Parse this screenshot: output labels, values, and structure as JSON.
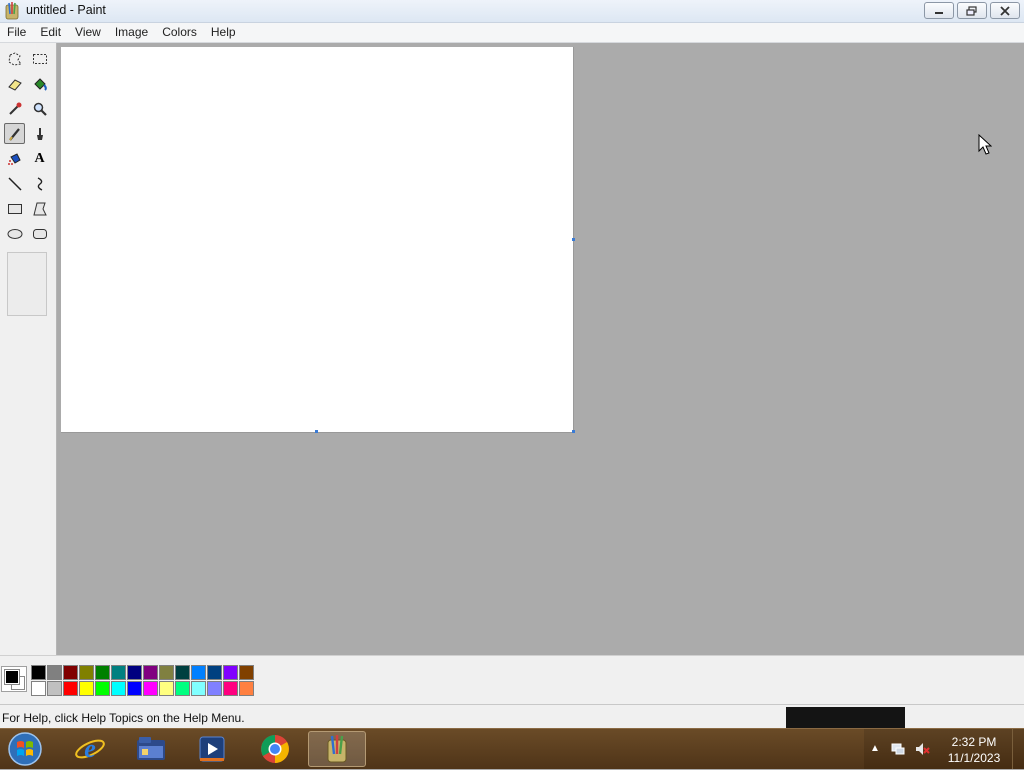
{
  "window": {
    "title": "untitled - Paint",
    "app_icon": "paint-brush-icon",
    "controls": [
      "minimize-icon",
      "restore-icon",
      "close-icon"
    ]
  },
  "menubar": {
    "items": [
      {
        "label": "File"
      },
      {
        "label": "Edit"
      },
      {
        "label": "View"
      },
      {
        "label": "Image"
      },
      {
        "label": "Colors"
      },
      {
        "label": "Help"
      }
    ]
  },
  "toolbox": {
    "tools": [
      {
        "name": "free-form-select-icon"
      },
      {
        "name": "rectangle-select-icon"
      },
      {
        "name": "eraser-icon"
      },
      {
        "name": "fill-bucket-icon"
      },
      {
        "name": "color-picker-icon"
      },
      {
        "name": "magnifier-icon"
      },
      {
        "name": "pencil-icon",
        "active": true
      },
      {
        "name": "brush-icon"
      },
      {
        "name": "airbrush-icon"
      },
      {
        "name": "text-icon",
        "glyph": "A"
      },
      {
        "name": "line-icon"
      },
      {
        "name": "curve-icon"
      },
      {
        "name": "rectangle-icon"
      },
      {
        "name": "polygon-icon"
      },
      {
        "name": "ellipse-icon"
      },
      {
        "name": "rounded-rectangle-icon"
      }
    ]
  },
  "palette": {
    "foreground": "#000000",
    "background": "#ffffff",
    "row1": [
      "#000000",
      "#808080",
      "#800000",
      "#808000",
      "#008000",
      "#008080",
      "#000080",
      "#800080",
      "#808040",
      "#004040",
      "#0080ff",
      "#004080",
      "#8000ff",
      "#804000"
    ],
    "row2": [
      "#ffffff",
      "#c0c0c0",
      "#ff0000",
      "#ffff00",
      "#00ff00",
      "#00ffff",
      "#0000ff",
      "#ff00ff",
      "#ffff80",
      "#00ff80",
      "#80ffff",
      "#8080ff",
      "#ff0080",
      "#ff8040"
    ]
  },
  "statusbar": {
    "help_text": "For Help, click Help Topics on the Help Menu."
  },
  "taskbar": {
    "start_icon": "windows-start-icon",
    "apps": [
      {
        "name": "internet-explorer-icon"
      },
      {
        "name": "file-explorer-icon"
      },
      {
        "name": "media-player-icon"
      },
      {
        "name": "chrome-icon"
      },
      {
        "name": "paint-taskbar-icon",
        "active": true
      }
    ],
    "clock": {
      "time": "2:32 PM",
      "date": "11/1/2023"
    }
  }
}
